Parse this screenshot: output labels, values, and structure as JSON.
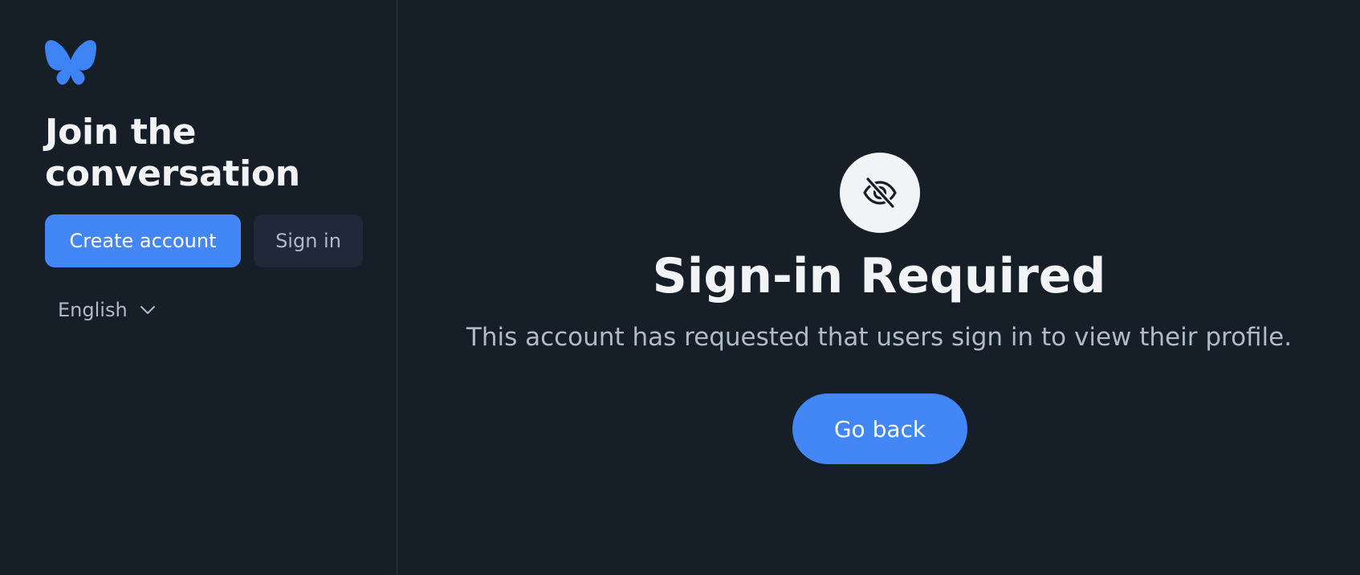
{
  "sidebar": {
    "logo_icon": "butterfly-logo-icon",
    "headline": "Join the conversation",
    "create_account_label": "Create account",
    "sign_in_label": "Sign in",
    "language": {
      "selected": "English",
      "icon": "chevron-down-icon"
    }
  },
  "main": {
    "icon": "eye-slash-icon",
    "title": "Sign-in Required",
    "description": "This account has requested that users sign in to view their profile.",
    "go_back_label": "Go back"
  },
  "colors": {
    "background": "#161e27",
    "accent": "#4287f5",
    "secondary_button": "#1f2937",
    "muted_text": "#aebbc9",
    "primary_text": "#f1f3f5",
    "divider": "#2e3a49"
  }
}
